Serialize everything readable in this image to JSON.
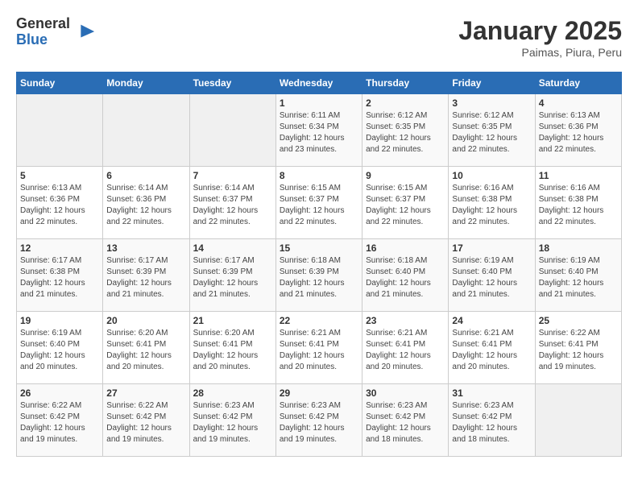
{
  "logo": {
    "general": "General",
    "blue": "Blue"
  },
  "header": {
    "title": "January 2025",
    "subtitle": "Paimas, Piura, Peru"
  },
  "weekdays": [
    "Sunday",
    "Monday",
    "Tuesday",
    "Wednesday",
    "Thursday",
    "Friday",
    "Saturday"
  ],
  "weeks": [
    [
      {
        "day": "",
        "sunrise": "",
        "sunset": "",
        "daylight": ""
      },
      {
        "day": "",
        "sunrise": "",
        "sunset": "",
        "daylight": ""
      },
      {
        "day": "",
        "sunrise": "",
        "sunset": "",
        "daylight": ""
      },
      {
        "day": "1",
        "sunrise": "Sunrise: 6:11 AM",
        "sunset": "Sunset: 6:34 PM",
        "daylight": "Daylight: 12 hours and 23 minutes."
      },
      {
        "day": "2",
        "sunrise": "Sunrise: 6:12 AM",
        "sunset": "Sunset: 6:35 PM",
        "daylight": "Daylight: 12 hours and 22 minutes."
      },
      {
        "day": "3",
        "sunrise": "Sunrise: 6:12 AM",
        "sunset": "Sunset: 6:35 PM",
        "daylight": "Daylight: 12 hours and 22 minutes."
      },
      {
        "day": "4",
        "sunrise": "Sunrise: 6:13 AM",
        "sunset": "Sunset: 6:36 PM",
        "daylight": "Daylight: 12 hours and 22 minutes."
      }
    ],
    [
      {
        "day": "5",
        "sunrise": "Sunrise: 6:13 AM",
        "sunset": "Sunset: 6:36 PM",
        "daylight": "Daylight: 12 hours and 22 minutes."
      },
      {
        "day": "6",
        "sunrise": "Sunrise: 6:14 AM",
        "sunset": "Sunset: 6:36 PM",
        "daylight": "Daylight: 12 hours and 22 minutes."
      },
      {
        "day": "7",
        "sunrise": "Sunrise: 6:14 AM",
        "sunset": "Sunset: 6:37 PM",
        "daylight": "Daylight: 12 hours and 22 minutes."
      },
      {
        "day": "8",
        "sunrise": "Sunrise: 6:15 AM",
        "sunset": "Sunset: 6:37 PM",
        "daylight": "Daylight: 12 hours and 22 minutes."
      },
      {
        "day": "9",
        "sunrise": "Sunrise: 6:15 AM",
        "sunset": "Sunset: 6:37 PM",
        "daylight": "Daylight: 12 hours and 22 minutes."
      },
      {
        "day": "10",
        "sunrise": "Sunrise: 6:16 AM",
        "sunset": "Sunset: 6:38 PM",
        "daylight": "Daylight: 12 hours and 22 minutes."
      },
      {
        "day": "11",
        "sunrise": "Sunrise: 6:16 AM",
        "sunset": "Sunset: 6:38 PM",
        "daylight": "Daylight: 12 hours and 22 minutes."
      }
    ],
    [
      {
        "day": "12",
        "sunrise": "Sunrise: 6:17 AM",
        "sunset": "Sunset: 6:38 PM",
        "daylight": "Daylight: 12 hours and 21 minutes."
      },
      {
        "day": "13",
        "sunrise": "Sunrise: 6:17 AM",
        "sunset": "Sunset: 6:39 PM",
        "daylight": "Daylight: 12 hours and 21 minutes."
      },
      {
        "day": "14",
        "sunrise": "Sunrise: 6:17 AM",
        "sunset": "Sunset: 6:39 PM",
        "daylight": "Daylight: 12 hours and 21 minutes."
      },
      {
        "day": "15",
        "sunrise": "Sunrise: 6:18 AM",
        "sunset": "Sunset: 6:39 PM",
        "daylight": "Daylight: 12 hours and 21 minutes."
      },
      {
        "day": "16",
        "sunrise": "Sunrise: 6:18 AM",
        "sunset": "Sunset: 6:40 PM",
        "daylight": "Daylight: 12 hours and 21 minutes."
      },
      {
        "day": "17",
        "sunrise": "Sunrise: 6:19 AM",
        "sunset": "Sunset: 6:40 PM",
        "daylight": "Daylight: 12 hours and 21 minutes."
      },
      {
        "day": "18",
        "sunrise": "Sunrise: 6:19 AM",
        "sunset": "Sunset: 6:40 PM",
        "daylight": "Daylight: 12 hours and 21 minutes."
      }
    ],
    [
      {
        "day": "19",
        "sunrise": "Sunrise: 6:19 AM",
        "sunset": "Sunset: 6:40 PM",
        "daylight": "Daylight: 12 hours and 20 minutes."
      },
      {
        "day": "20",
        "sunrise": "Sunrise: 6:20 AM",
        "sunset": "Sunset: 6:41 PM",
        "daylight": "Daylight: 12 hours and 20 minutes."
      },
      {
        "day": "21",
        "sunrise": "Sunrise: 6:20 AM",
        "sunset": "Sunset: 6:41 PM",
        "daylight": "Daylight: 12 hours and 20 minutes."
      },
      {
        "day": "22",
        "sunrise": "Sunrise: 6:21 AM",
        "sunset": "Sunset: 6:41 PM",
        "daylight": "Daylight: 12 hours and 20 minutes."
      },
      {
        "day": "23",
        "sunrise": "Sunrise: 6:21 AM",
        "sunset": "Sunset: 6:41 PM",
        "daylight": "Daylight: 12 hours and 20 minutes."
      },
      {
        "day": "24",
        "sunrise": "Sunrise: 6:21 AM",
        "sunset": "Sunset: 6:41 PM",
        "daylight": "Daylight: 12 hours and 20 minutes."
      },
      {
        "day": "25",
        "sunrise": "Sunrise: 6:22 AM",
        "sunset": "Sunset: 6:41 PM",
        "daylight": "Daylight: 12 hours and 19 minutes."
      }
    ],
    [
      {
        "day": "26",
        "sunrise": "Sunrise: 6:22 AM",
        "sunset": "Sunset: 6:42 PM",
        "daylight": "Daylight: 12 hours and 19 minutes."
      },
      {
        "day": "27",
        "sunrise": "Sunrise: 6:22 AM",
        "sunset": "Sunset: 6:42 PM",
        "daylight": "Daylight: 12 hours and 19 minutes."
      },
      {
        "day": "28",
        "sunrise": "Sunrise: 6:23 AM",
        "sunset": "Sunset: 6:42 PM",
        "daylight": "Daylight: 12 hours and 19 minutes."
      },
      {
        "day": "29",
        "sunrise": "Sunrise: 6:23 AM",
        "sunset": "Sunset: 6:42 PM",
        "daylight": "Daylight: 12 hours and 19 minutes."
      },
      {
        "day": "30",
        "sunrise": "Sunrise: 6:23 AM",
        "sunset": "Sunset: 6:42 PM",
        "daylight": "Daylight: 12 hours and 18 minutes."
      },
      {
        "day": "31",
        "sunrise": "Sunrise: 6:23 AM",
        "sunset": "Sunset: 6:42 PM",
        "daylight": "Daylight: 12 hours and 18 minutes."
      },
      {
        "day": "",
        "sunrise": "",
        "sunset": "",
        "daylight": ""
      }
    ]
  ]
}
